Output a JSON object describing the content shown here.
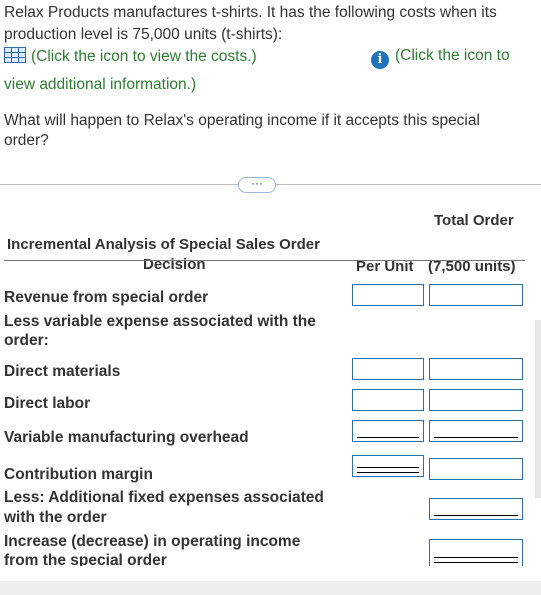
{
  "intro": {
    "line1": "Relax Products manufactures t-shirts. It has the following costs when its",
    "line2": "production level is 75,000 units (t-shirts):",
    "costs_link": "(Click the icon to view the costs.)",
    "info_link_part1": "(Click the icon to",
    "info_link_part2": "view additional information.)"
  },
  "question": {
    "line1": "What will happen to Relax's operating income if it accepts this special",
    "line2": "order?"
  },
  "expand_button": "···",
  "table": {
    "header_total_order": "Total Order",
    "title_line1": "Incremental Analysis of Special Sales Order",
    "title_line2": "Decision",
    "col_per_unit": "Per Unit",
    "col_total": "(7,500 units)",
    "rows": {
      "revenue": "Revenue from special order",
      "less_variable_line1": "Less variable expense associated with the",
      "less_variable_line2": "order:",
      "direct_materials": "Direct materials",
      "direct_labor": "Direct labor",
      "variable_overhead": "Variable manufacturing overhead",
      "contribution_margin": "Contribution margin",
      "less_fixed_line1": "Less: Additional fixed expenses associated",
      "less_fixed_line2": "with the order",
      "increase_line1": "Increase (decrease) in operating income",
      "increase_line2": "from the special order"
    },
    "inputs": {
      "revenue_per_unit": "",
      "revenue_total": "",
      "dm_per_unit": "",
      "dm_total": "",
      "dl_per_unit": "",
      "dl_total": "",
      "voh_per_unit": "",
      "voh_total": "",
      "cm_per_unit": "",
      "cm_total": "",
      "fixed_total": "",
      "increase_total": ""
    }
  },
  "colors": {
    "link": "#2e7d32",
    "input_border": "#2b6fb0",
    "info_icon": "#1e73be"
  },
  "icons": {
    "costs": "table-grid-icon",
    "info": "info-icon"
  }
}
